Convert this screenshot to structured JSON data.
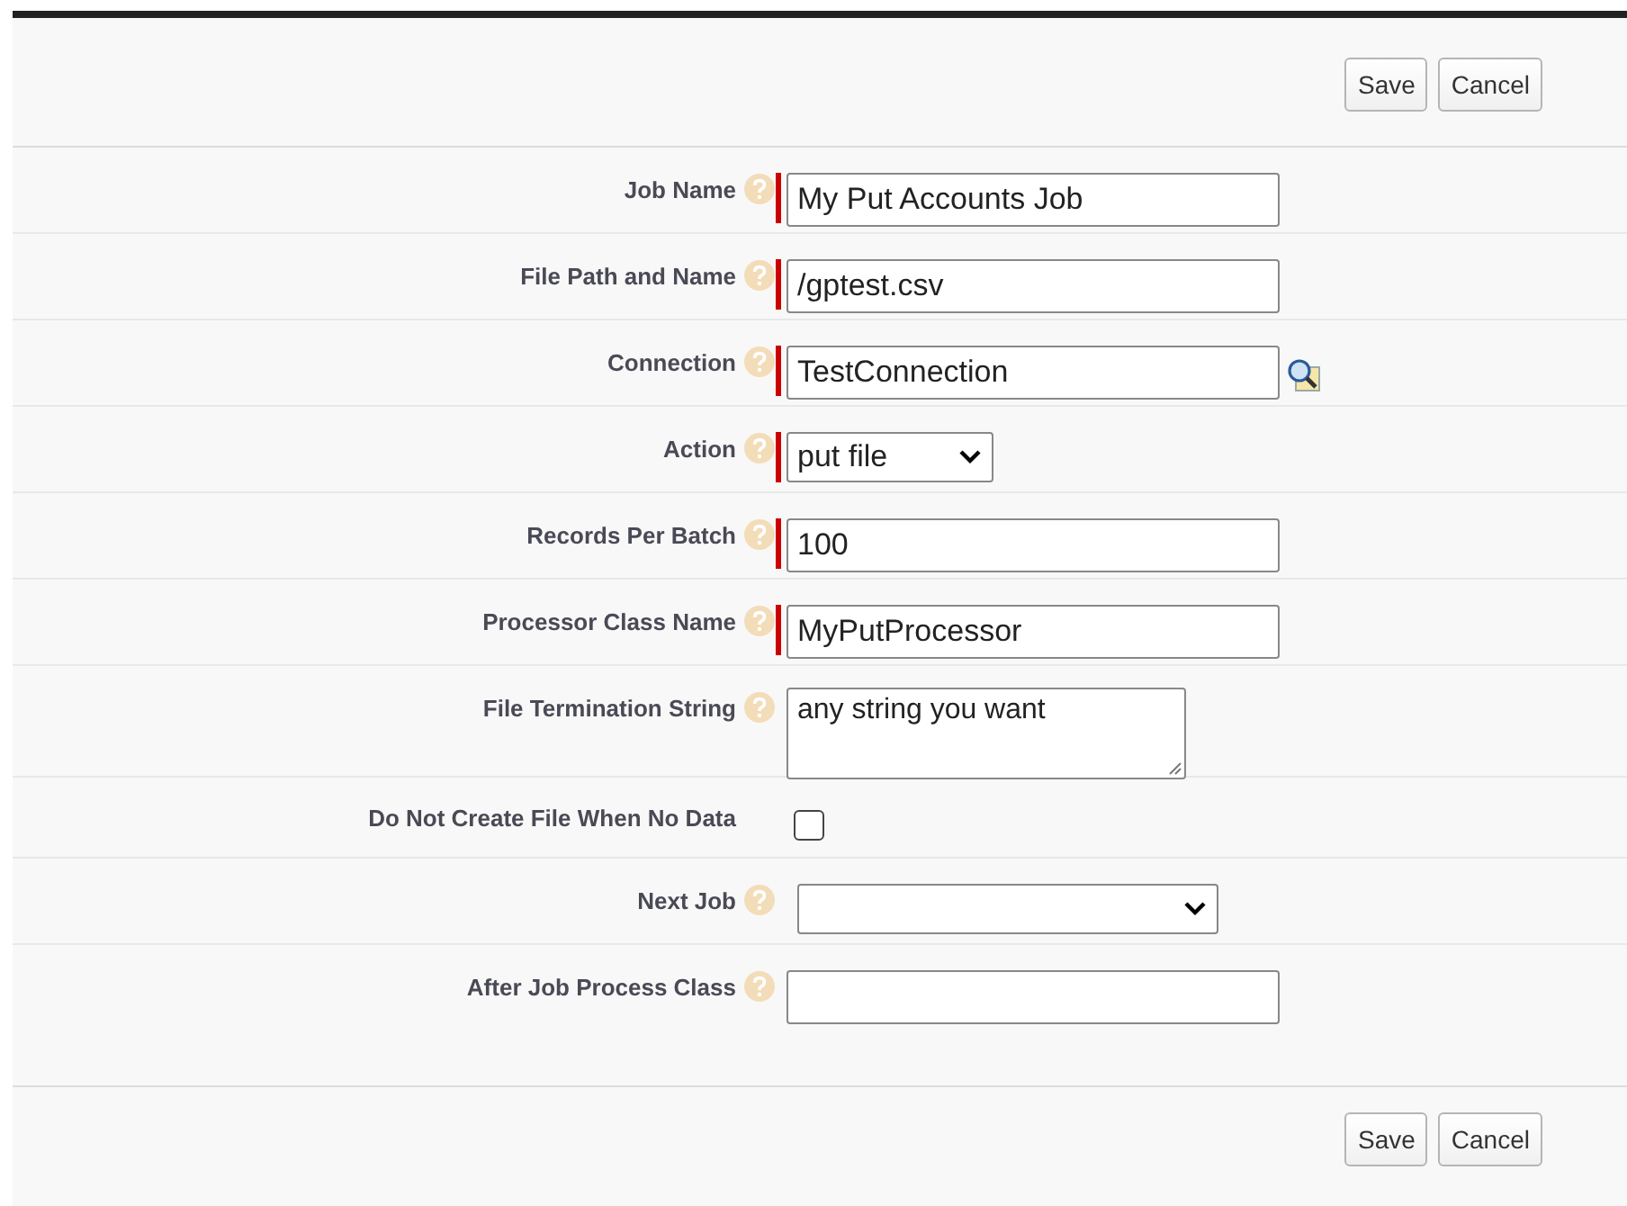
{
  "top_buttons": [
    "Save",
    "Cancel"
  ],
  "fields": [
    {
      "label": "Job Name",
      "kind": "text",
      "value": "My Put Accounts Job",
      "required": true,
      "help": true
    },
    {
      "label": "File Path and Name",
      "kind": "text",
      "value": "/gptest.csv",
      "required": true,
      "help": true
    },
    {
      "label": "Connection",
      "kind": "lookup",
      "value": "TestConnection",
      "required": true,
      "help": true
    },
    {
      "label": "Action",
      "kind": "select",
      "value": "put file",
      "required": true,
      "help": true
    },
    {
      "label": "Records Per Batch",
      "kind": "text",
      "value": "100",
      "required": true,
      "help": true
    },
    {
      "label": "Processor Class Name",
      "kind": "text",
      "value": "MyPutProcessor",
      "required": true,
      "help": true
    },
    {
      "label": "File Termination String",
      "kind": "textarea",
      "value": "any string you want",
      "required": false,
      "help": true
    },
    {
      "label": "Do Not Create File When No Data",
      "kind": "checkbox",
      "checked": false,
      "required": false,
      "help": false
    },
    {
      "label": "Next Job",
      "kind": "wideselect",
      "required": false,
      "help": true
    },
    {
      "label": "After Job Process Class",
      "kind": "text",
      "required": false,
      "help": true
    }
  ],
  "bottom_buttons": [
    "Save",
    "Cancel"
  ]
}
